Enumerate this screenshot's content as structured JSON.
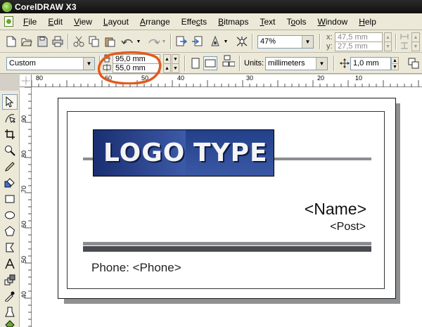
{
  "window": {
    "title": "CorelDRAW X3"
  },
  "menu": [
    {
      "pre": "",
      "u": "F",
      "post": "ile"
    },
    {
      "pre": "",
      "u": "E",
      "post": "dit"
    },
    {
      "pre": "",
      "u": "V",
      "post": "iew"
    },
    {
      "pre": "",
      "u": "L",
      "post": "ayout"
    },
    {
      "pre": "",
      "u": "A",
      "post": "rrange"
    },
    {
      "pre": "Effe",
      "u": "c",
      "post": "ts"
    },
    {
      "pre": "",
      "u": "B",
      "post": "itmaps"
    },
    {
      "pre": "",
      "u": "T",
      "post": "ext"
    },
    {
      "pre": "T",
      "u": "o",
      "post": "ols"
    },
    {
      "pre": "",
      "u": "W",
      "post": "indow"
    },
    {
      "pre": "",
      "u": "H",
      "post": "elp"
    }
  ],
  "standard_toolbar": {
    "zoom": "47%",
    "pos_x_label": "x:",
    "pos_x": "47,5 mm",
    "pos_y_label": "y:",
    "pos_y": "27,5 mm"
  },
  "property_bar": {
    "paper_type": "Custom",
    "width": "95,0 mm",
    "height": "55,0 mm",
    "units_label": "Units:",
    "units": "millimeters",
    "nudge": "1,0 mm"
  },
  "ruler": {
    "h_labels": [
      "80",
      "60",
      "50",
      "40",
      "30",
      "20",
      "10"
    ],
    "v_labels": [
      "90",
      "80",
      "70",
      "60",
      "50",
      "40"
    ]
  },
  "card": {
    "logo_left": "LOGO",
    "logo_right": "TYPE",
    "name": "<Name>",
    "post": "<Post>",
    "phone": "Phone: <Phone>"
  },
  "colors": {
    "logo_blue": "#2b4a95",
    "annotation": "#e35a1e",
    "line_gray": "#8b8d92",
    "line_dark": "#4b4c50"
  }
}
